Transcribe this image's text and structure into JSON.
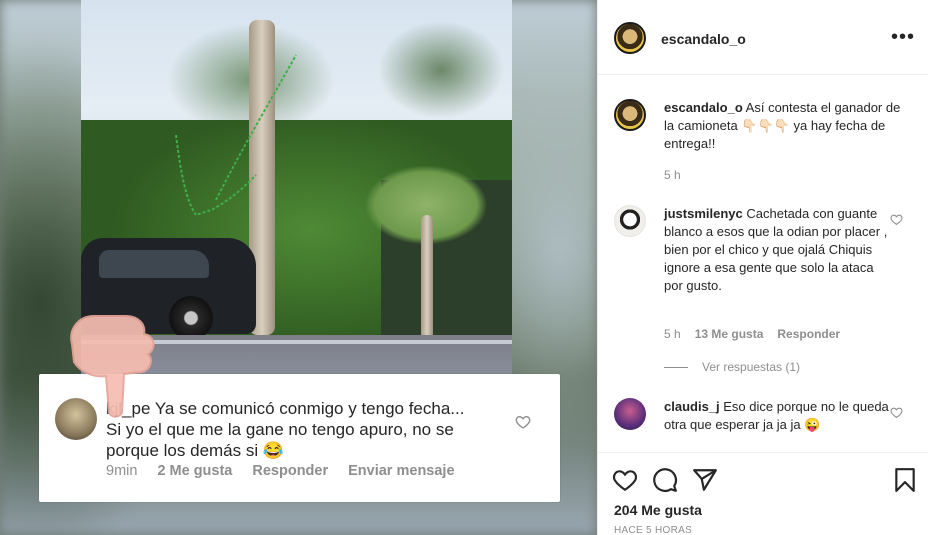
{
  "post": {
    "author": "escandalo_o",
    "more_label": "•••"
  },
  "overlay_comment": {
    "username": "kjl_pe",
    "line1": "kjl_pe Ya se comunicó conmigo y tengo fecha...",
    "line2": "Si yo el que me la gane no tengo apuro, no se",
    "line3": "porque los demás si 😂",
    "time": "9min",
    "likes": "2 Me gusta",
    "reply": "Responder",
    "message": "Enviar mensaje"
  },
  "caption": {
    "username": "escandalo_o",
    "text": "Así contesta el ganador de la camioneta 👇🏻👇🏻👇🏻 ya hay fecha de entrega!!",
    "time": "5 h"
  },
  "comments": [
    {
      "username": "justsmilenyc",
      "text": "Cachetada con guante blanco a esos que la odian por placer , bien por el chico y que ojalá Chiquis ignore a esa gente que solo la ataca por gusto.",
      "time": "5 h",
      "likes": "13 Me gusta",
      "reply": "Responder"
    },
    {
      "username": "claudis_j",
      "text": "Eso dice porque no le queda otra que esperar ja ja ja 😜"
    }
  ],
  "view_replies": "Ver respuestas (1)",
  "likes_count": "204 Me gusta",
  "posted_ago": "HACE 5 HORAS",
  "icons": [
    "heart-icon",
    "comment-icon",
    "share-icon",
    "bookmark-icon",
    "more-icon"
  ]
}
